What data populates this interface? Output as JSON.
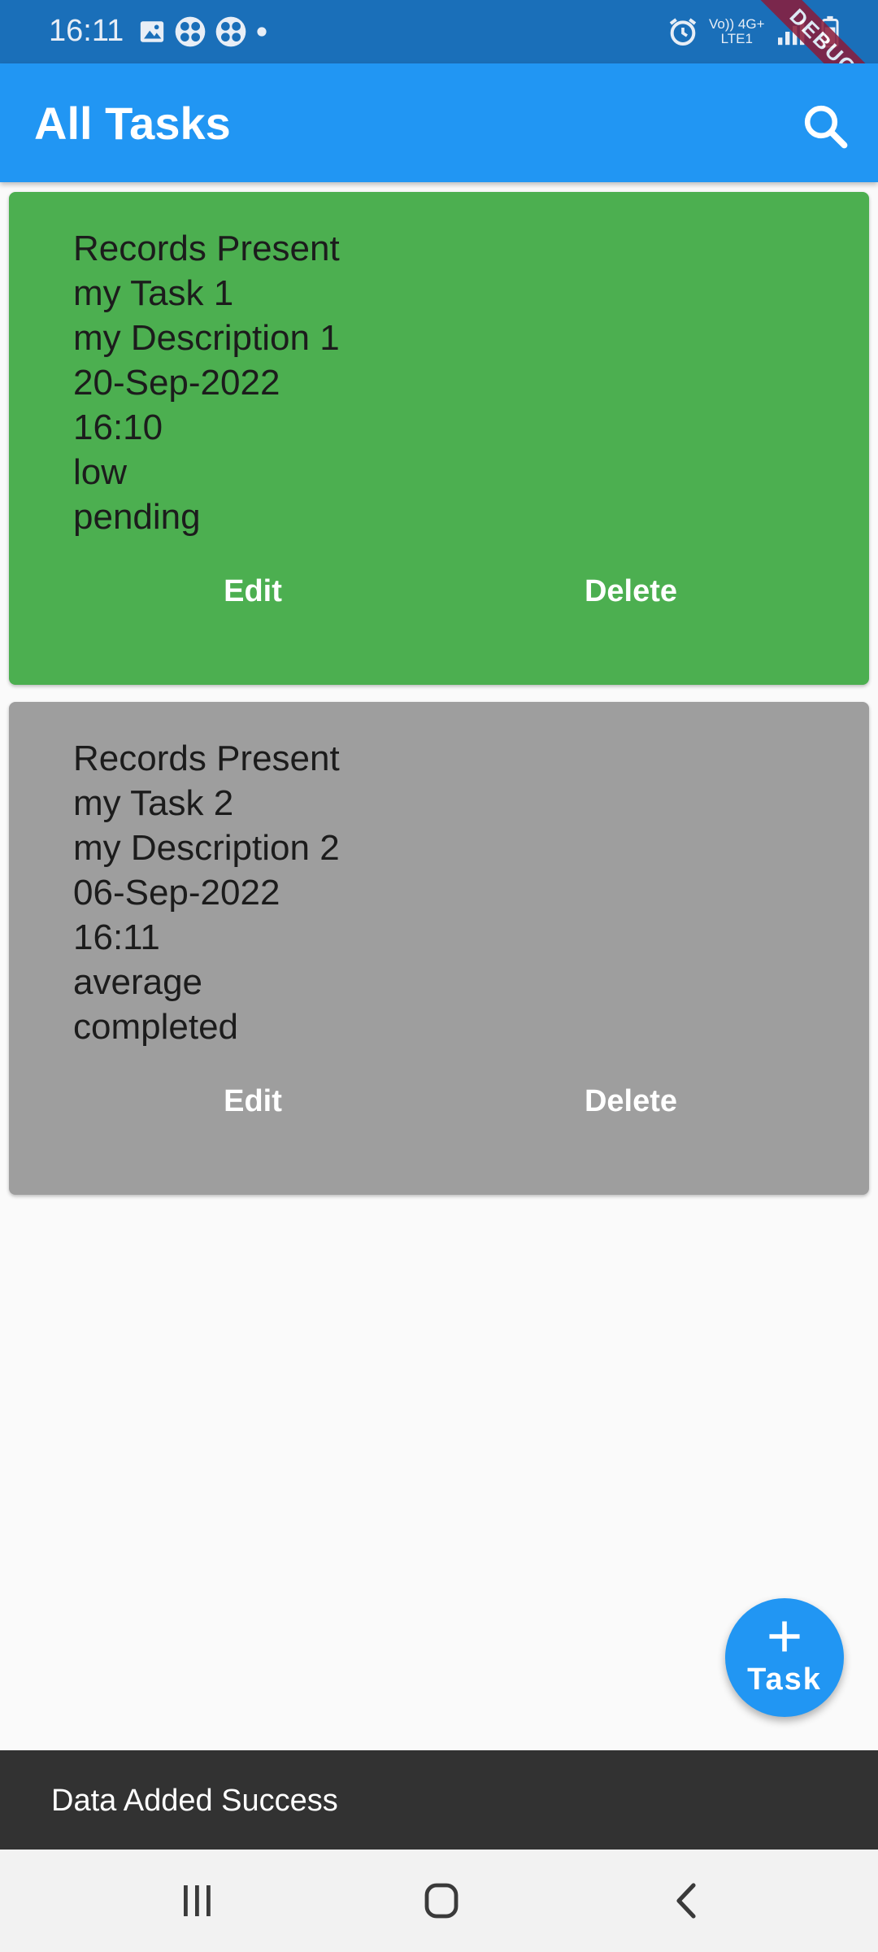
{
  "status_bar": {
    "time": "16:11",
    "left_icons": [
      "image-icon",
      "pinwheel-icon",
      "pinwheel-icon",
      "dot-icon"
    ],
    "net_line1": "Vo)) 4G+",
    "net_line2": "LTE1",
    "debug_label": "DEBUG"
  },
  "app_bar": {
    "title": "All Tasks",
    "color": "#2196f3"
  },
  "tasks": [
    {
      "lines": [
        "Records Present",
        "my Task 1",
        "my Description 1",
        "20-Sep-2022",
        "16:10",
        "low",
        "pending"
      ],
      "edit_label": "Edit",
      "delete_label": "Delete",
      "color": "#4caf50"
    },
    {
      "lines": [
        "Records Present",
        "my Task 2",
        "my Description 2",
        "06-Sep-2022",
        "16:11",
        "average",
        "completed"
      ],
      "edit_label": "Edit",
      "delete_label": "Delete",
      "color": "#9e9e9e"
    }
  ],
  "fab": {
    "label": "Task",
    "icon": "plus-icon"
  },
  "snackbar": {
    "message": "Data Added Success"
  },
  "nav_bar": {
    "icons": [
      "recents-icon",
      "home-icon",
      "back-icon"
    ]
  }
}
